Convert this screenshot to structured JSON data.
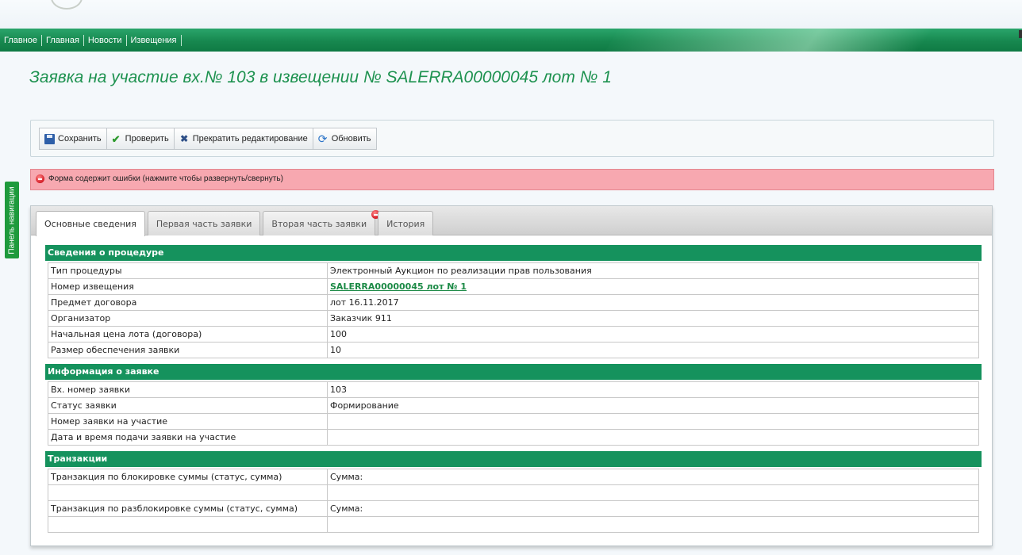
{
  "nav": [
    "Главное",
    "Главная",
    "Новости",
    "Извещения"
  ],
  "page": {
    "title": "Заявка на участие вх.№ 103 в извещении № SALERRA00000045 лот № 1"
  },
  "toolbar": {
    "save": "Сохранить",
    "check": "Проверить",
    "stop_edit": "Прекратить редактирование",
    "refresh": "Обновить"
  },
  "error_bar": {
    "text": "Форма содержит ошибки (нажмите чтобы развернуть/свернуть)"
  },
  "nav_panel": "Панель навигации",
  "tabs": [
    {
      "label": "Основные сведения",
      "active": true
    },
    {
      "label": "Первая часть заявки",
      "active": false
    },
    {
      "label": "Вторая часть заявки",
      "active": false,
      "error": true
    },
    {
      "label": "История",
      "active": false
    }
  ],
  "sections": {
    "procedure": {
      "title": "Сведения о процедуре",
      "rows": [
        {
          "label": "Тип процедуры",
          "value": "Электронный Аукцион по реализации прав пользования"
        },
        {
          "label": "Номер извещения",
          "value": "SALERRA00000045 лот № 1",
          "link": true
        },
        {
          "label": "Предмет договора",
          "value": "лот 16.11.2017"
        },
        {
          "label": "Организатор",
          "value": "Заказчик 911"
        },
        {
          "label": "Начальная цена лота (договора)",
          "value": "100"
        },
        {
          "label": "Размер обеспечения заявки",
          "value": "10"
        }
      ]
    },
    "application": {
      "title": "Информация о заявке",
      "rows": [
        {
          "label": "Вх. номер заявки",
          "value": "103"
        },
        {
          "label": "Статус заявки",
          "value": "Формирование"
        },
        {
          "label": "Номер заявки на участие",
          "value": ""
        },
        {
          "label": "Дата и время подачи заявки на участие",
          "value": ""
        }
      ]
    },
    "transactions": {
      "title": "Транзакции",
      "rows": [
        {
          "label": "Транзакция по блокировке суммы (статус, сумма)",
          "value": "Сумма:"
        },
        {
          "label": "",
          "value": ""
        },
        {
          "label": "Транзакция по разблокировке суммы (статус, сумма)",
          "value": "Сумма:"
        },
        {
          "label": "",
          "value": ""
        }
      ]
    }
  },
  "colors": {
    "brand_green": "#15925d",
    "title_green": "#1e9250",
    "error_bg": "#f7a8b0"
  }
}
